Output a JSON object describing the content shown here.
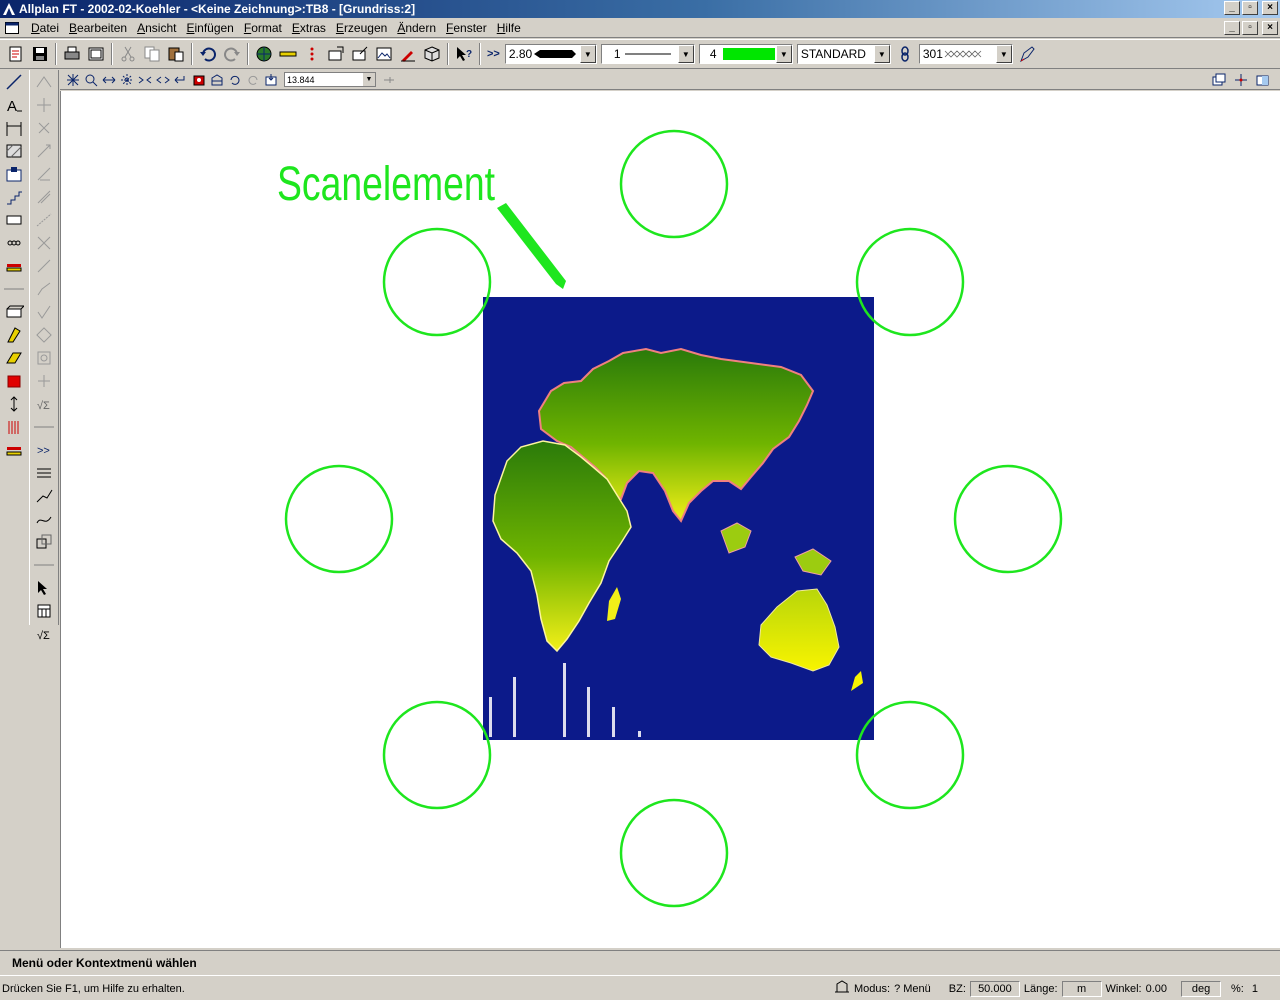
{
  "window": {
    "title": "Allplan FT - 2002-02-Koehler - <Keine Zeichnung>:TB8 - [Grundriss:2]",
    "controls": {
      "minimize": "_",
      "restore": "▫",
      "close": "×"
    }
  },
  "menu": {
    "items": [
      {
        "key": "D",
        "rest": "atei"
      },
      {
        "key": "B",
        "rest": "earbeiten"
      },
      {
        "key": "A",
        "rest": "nsicht"
      },
      {
        "key": "E",
        "rest": "infügen"
      },
      {
        "key": "F",
        "rest": "ormat"
      },
      {
        "key": "E",
        "rest": "xtras"
      },
      {
        "key": "E",
        "rest": "rzeugen"
      },
      {
        "key": "Ä",
        "rest": "ndern"
      },
      {
        "key": "F",
        "rest": "enster"
      },
      {
        "key": "H",
        "rest": "ilfe"
      }
    ]
  },
  "toolbar": {
    "expand": ">>",
    "pen_thickness": "2.80",
    "line_type": "1",
    "color_number": "4",
    "layer": "STANDARD",
    "pattern_number": "301"
  },
  "viewbar": {
    "zoom_value": "13.844"
  },
  "canvas": {
    "annotation_text": "Scanelement",
    "accent_color": "#1ee61e",
    "map_background": "#0c1a8a"
  },
  "message": {
    "prompt": "Menü oder Kontextmenü wählen"
  },
  "status": {
    "help": "Drücken Sie F1, um Hilfe zu erhalten.",
    "modus_label": "Modus:",
    "modus_value": "? Menü",
    "bz_label": "BZ:",
    "bz_value": "50.000",
    "laenge_label": "Länge:",
    "laenge_unit": "m",
    "winkel_label": "Winkel:",
    "winkel_value": "0.00",
    "winkel_unit": "deg",
    "percent_label": "%:",
    "percent_value": "1"
  }
}
